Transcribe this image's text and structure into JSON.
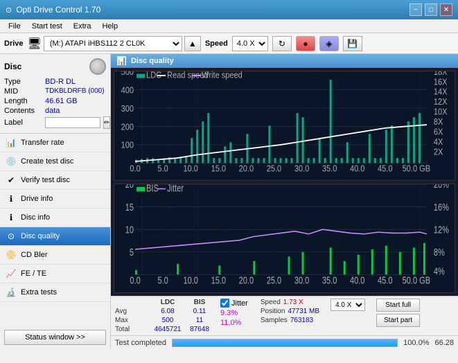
{
  "window": {
    "title": "Opti Drive Control 1.70",
    "icon": "⊙"
  },
  "titlebar_controls": [
    "−",
    "□",
    "✕"
  ],
  "menubar": {
    "items": [
      "File",
      "Start test",
      "Extra",
      "Help"
    ]
  },
  "drivebar": {
    "label": "Drive",
    "drive_value": "(M:) ATAPI iHBS112  2 CL0K",
    "speed_label": "Speed",
    "speed_value": "4.0 X"
  },
  "disc": {
    "header": "Disc",
    "type_label": "Type",
    "type_value": "BD-R DL",
    "mid_label": "MID",
    "mid_value": "TDKBLDRFB (000)",
    "length_label": "Length",
    "length_value": "46.61 GB",
    "contents_label": "Contents",
    "contents_value": "data",
    "label_label": "Label",
    "label_value": ""
  },
  "nav_items": [
    {
      "id": "transfer-rate",
      "label": "Transfer rate",
      "active": false
    },
    {
      "id": "create-test-disc",
      "label": "Create test disc",
      "active": false
    },
    {
      "id": "verify-test-disc",
      "label": "Verify test disc",
      "active": false
    },
    {
      "id": "drive-info",
      "label": "Drive info",
      "active": false
    },
    {
      "id": "disc-info",
      "label": "Disc info",
      "active": false
    },
    {
      "id": "disc-quality",
      "label": "Disc quality",
      "active": true
    },
    {
      "id": "cd-bler",
      "label": "CD Bler",
      "active": false
    },
    {
      "id": "fe-te",
      "label": "FE / TE",
      "active": false
    },
    {
      "id": "extra-tests",
      "label": "Extra tests",
      "active": false
    }
  ],
  "status_button": "Status window >>",
  "chart": {
    "title": "Disc quality",
    "legend_top": [
      "LDC",
      "Read speed",
      "Write speed"
    ],
    "legend_bottom": [
      "BIS",
      "Jitter"
    ],
    "top_y_max": 500,
    "top_y_labels": [
      500,
      400,
      300,
      200,
      100
    ],
    "top_y_right_labels": [
      "18X",
      "16X",
      "14X",
      "12X",
      "10X",
      "8X",
      "6X",
      "4X",
      "2X"
    ],
    "bottom_y_max": 20,
    "bottom_y_labels": [
      20,
      15,
      10,
      5
    ],
    "x_labels": [
      "0.0",
      "5.0",
      "10.0",
      "15.0",
      "20.0",
      "25.0",
      "30.0",
      "35.0",
      "40.0",
      "45.0",
      "50.0 GB"
    ]
  },
  "stats": {
    "columns": [
      "LDC",
      "BIS"
    ],
    "jitter_label": "Jitter",
    "jitter_checked": true,
    "speed_label": "Speed",
    "speed_value": "1.73 X",
    "speed_select": "4.0 X",
    "avg_label": "Avg",
    "avg_ldc": "6.08",
    "avg_bis": "0.11",
    "avg_jitter": "9.3%",
    "max_label": "Max",
    "max_ldc": "500",
    "max_bis": "11",
    "max_jitter": "11.0%",
    "position_label": "Position",
    "position_value": "47731 MB",
    "total_label": "Total",
    "total_ldc": "4645721",
    "total_bis": "87648",
    "samples_label": "Samples",
    "samples_value": "763183",
    "start_full_btn": "Start full",
    "start_part_btn": "Start part"
  },
  "statusbar": {
    "text": "Test completed",
    "progress": 100,
    "pct": "100.0%",
    "num": "66.28"
  }
}
